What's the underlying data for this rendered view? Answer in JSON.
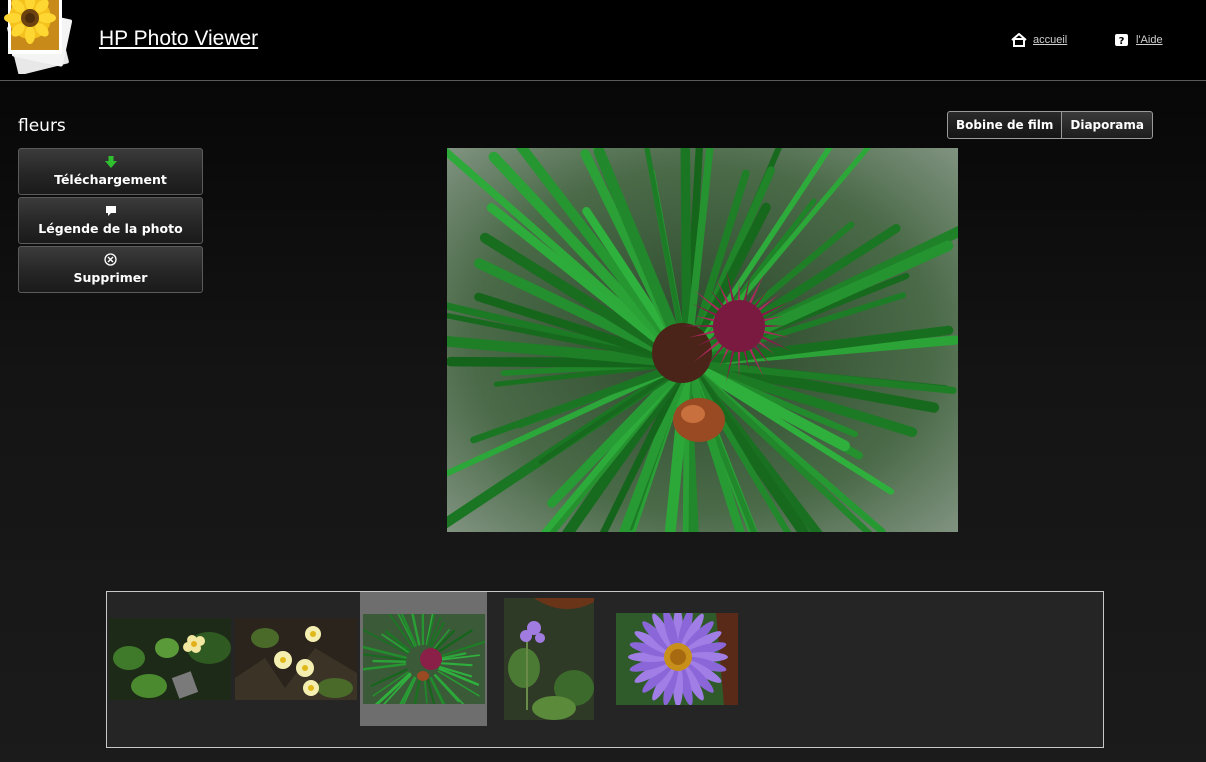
{
  "app": {
    "title": "HP Photo Viewer",
    "logo_icon": "sunflower-photo-stack-icon"
  },
  "header": {
    "home_label": "accueil",
    "home_icon": "house-icon",
    "help_label": "l'Aide",
    "help_icon": "help-icon"
  },
  "album": {
    "title": "fleurs"
  },
  "actions": [
    {
      "label": "Téléchargement",
      "icon": "download-arrow-icon",
      "icon_color": "#2fc02f"
    },
    {
      "label": "Légende de la photo",
      "icon": "speech-bubble-icon"
    },
    {
      "label": "Supprimer",
      "icon": "delete-circle-icon"
    }
  ],
  "view_modes": {
    "filmstrip_label": "Bobine de film",
    "slideshow_label": "Diaporama"
  },
  "filmstrip": {
    "selected_index": 2,
    "thumbnails": [
      {
        "subject": "yellow-white flowers among green leaves"
      },
      {
        "subject": "pale yellow flowers on dark ground"
      },
      {
        "subject": "pine cone bud among green needles"
      },
      {
        "subject": "purple flower with leaves"
      },
      {
        "subject": "purple aster with orange center"
      }
    ]
  },
  "colors": {
    "background": "#000000",
    "text": "#ffffff",
    "download_green": "#2fc02f",
    "selected_thumb_bg": "#6e6e6e"
  }
}
